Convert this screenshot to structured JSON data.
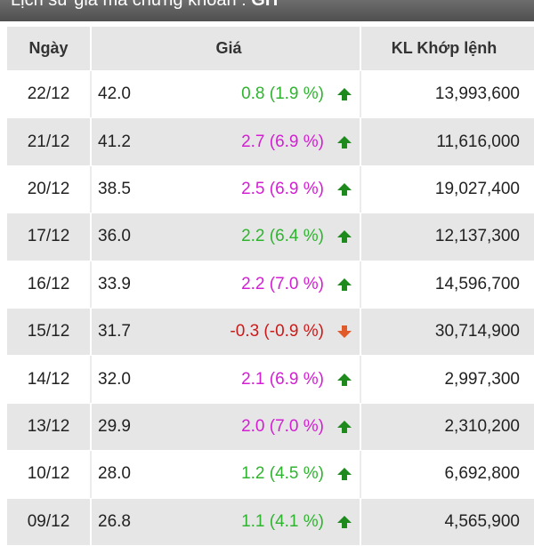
{
  "page_title": {
    "text": "Lịch sử giá mã chứng khoán :",
    "code": "GH"
  },
  "table": {
    "headers": {
      "date": "Ngày",
      "price": "Giá",
      "volume": "KL Khớp lệnh"
    },
    "rows": [
      {
        "date": "22/12",
        "price": "42.0",
        "change": "0.8 (1.9 %)",
        "direction": "up",
        "color": "#2fb42f",
        "volume": "13,993,600"
      },
      {
        "date": "21/12",
        "price": "41.2",
        "change": "2.7 (6.9 %)",
        "direction": "up",
        "color": "#d41ed4",
        "volume": "11,616,000"
      },
      {
        "date": "20/12",
        "price": "38.5",
        "change": "2.5 (6.9 %)",
        "direction": "up",
        "color": "#d41ed4",
        "volume": "19,027,400"
      },
      {
        "date": "17/12",
        "price": "36.0",
        "change": "2.2 (6.4 %)",
        "direction": "up",
        "color": "#2fb42f",
        "volume": "12,137,300"
      },
      {
        "date": "16/12",
        "price": "33.9",
        "change": "2.2 (7.0 %)",
        "direction": "up",
        "color": "#d41ed4",
        "volume": "14,596,700"
      },
      {
        "date": "15/12",
        "price": "31.7",
        "change": "-0.3 (-0.9 %)",
        "direction": "down",
        "color": "#cc1a1a",
        "volume": "30,714,900"
      },
      {
        "date": "14/12",
        "price": "32.0",
        "change": "2.1 (6.9 %)",
        "direction": "up",
        "color": "#d41ed4",
        "volume": "2,997,300"
      },
      {
        "date": "13/12",
        "price": "29.9",
        "change": "2.0 (7.0 %)",
        "direction": "up",
        "color": "#d41ed4",
        "volume": "2,310,200"
      },
      {
        "date": "10/12",
        "price": "28.0",
        "change": "1.2 (4.5 %)",
        "direction": "up",
        "color": "#2fb42f",
        "volume": "6,692,800"
      },
      {
        "date": "09/12",
        "price": "26.8",
        "change": "1.1 (4.1 %)",
        "direction": "up",
        "color": "#2fb42f",
        "volume": "4,565,900"
      }
    ]
  },
  "icons": {
    "up": "arrow-up-icon",
    "down": "arrow-down-icon"
  },
  "colors": {
    "up_arrow": "#1e8a1e",
    "down_arrow": "#e05a2a",
    "row_alt": "#e6e6e6"
  }
}
